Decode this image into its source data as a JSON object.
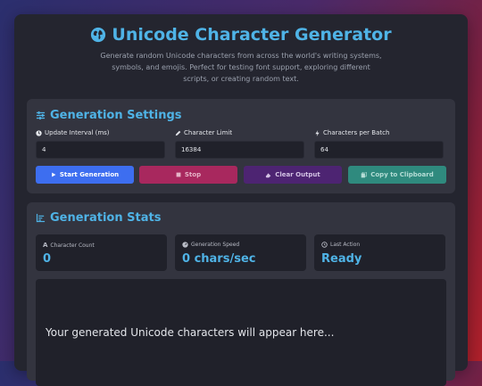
{
  "header": {
    "title": "Unicode Character Generator",
    "subtitle": "Generate random Unicode characters from across the world's writing systems, symbols, and emojis. Perfect for testing font support, exploring different scripts, or creating random text."
  },
  "settings": {
    "title": "Generation Settings",
    "fields": [
      {
        "label": "Update Interval (ms)",
        "value": "4",
        "icon": "clock-icon"
      },
      {
        "label": "Character Limit",
        "value": "16384",
        "icon": "pencil-icon"
      },
      {
        "label": "Characters per Batch",
        "value": "64",
        "icon": "lightning-icon"
      }
    ],
    "buttons": {
      "start": "Start Generation",
      "stop": "Stop",
      "clear": "Clear Output",
      "copy": "Copy to Clipboard"
    }
  },
  "stats": {
    "title": "Generation Stats",
    "items": [
      {
        "label": "Character Count",
        "value": "0",
        "icon": "letter-a-icon"
      },
      {
        "label": "Generation Speed",
        "value": "0 chars/sec",
        "icon": "speedometer-icon"
      },
      {
        "label": "Last Action",
        "value": "Ready",
        "icon": "history-icon"
      }
    ]
  },
  "output": {
    "placeholder": "Your generated Unicode characters will appear here..."
  },
  "colors": {
    "accent": "#4fb3e6",
    "start": "#3d6ef0",
    "stop": "#a8285e",
    "clear": "#4d2472",
    "copy": "#2f8a7e"
  }
}
